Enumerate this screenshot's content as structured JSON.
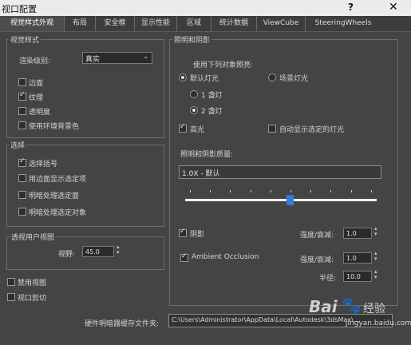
{
  "window": {
    "title": "视口配置",
    "help_glyph": "?",
    "close_glyph": "✕"
  },
  "tabs": [
    {
      "label": "视觉样式外观"
    },
    {
      "label": "布局"
    },
    {
      "label": "安全框"
    },
    {
      "label": "显示性能"
    },
    {
      "label": "区域"
    },
    {
      "label": "统计数据"
    },
    {
      "label": "ViewCube"
    },
    {
      "label": "SteeringWheels"
    }
  ],
  "active_tab": "视觉样式外观",
  "visual_style": {
    "group_label": "视觉样式",
    "render_level_label": "渲染级别:",
    "render_level_value": "真实",
    "options": [
      {
        "label": "边面",
        "checked": false
      },
      {
        "label": "纹理",
        "checked": true
      },
      {
        "label": "透明度",
        "checked": false
      },
      {
        "label": "使用环境背景色",
        "checked": false
      }
    ]
  },
  "selection": {
    "group_label": "选择",
    "options": [
      {
        "label": "选择括号",
        "checked": true
      },
      {
        "label": "用边面显示选定项",
        "checked": false
      },
      {
        "label": "明暗处理选定面",
        "checked": false
      },
      {
        "label": "明暗处理选定对象",
        "checked": false
      }
    ]
  },
  "perspective": {
    "group_label": "透视用户视图",
    "fov_label": "视野:",
    "fov_value": "45.0"
  },
  "disable_view": {
    "label": "禁用视图",
    "checked": false
  },
  "viewport_clip": {
    "label": "视口剪切",
    "checked": false
  },
  "lighting": {
    "group_label": "照明和阴影",
    "illuminate_label": "使用下列对象照亮:",
    "default_lights": {
      "label": "默认灯光",
      "checked": true
    },
    "scene_lights": {
      "label": "场景灯光",
      "checked": false
    },
    "one_light": {
      "label": "1 盏灯",
      "checked": false
    },
    "two_lights": {
      "label": "2 盏灯",
      "checked": true
    },
    "highlights": {
      "label": "高光",
      "checked": true
    },
    "auto_selected": {
      "label": "自动显示选定的灯光",
      "checked": false
    },
    "quality_label": "照明和阴影质量:",
    "quality_value": "1.0X - 默认",
    "quality_slider_fraction": 0.55,
    "shadows": {
      "label": "阴影",
      "checked": true
    },
    "shadow_intensity_label": "强度/衰减:",
    "shadow_intensity_value": "1.0",
    "ao": {
      "label": "Ambient Occlusion",
      "checked": true
    },
    "ao_intensity_label": "强度/衰减:",
    "ao_intensity_value": "1.0",
    "radius_label": "半径:",
    "radius_value": "10.0"
  },
  "cache": {
    "label": "硬件明暗器缓存文件夹:",
    "path": "C:\\Users\\Administrator\\AppData\\Local\\Autodesk\\3dsMax\\..."
  },
  "watermark": {
    "brand": "Bai",
    "brand2": "经验",
    "url": "jingyan.baidu.com"
  }
}
